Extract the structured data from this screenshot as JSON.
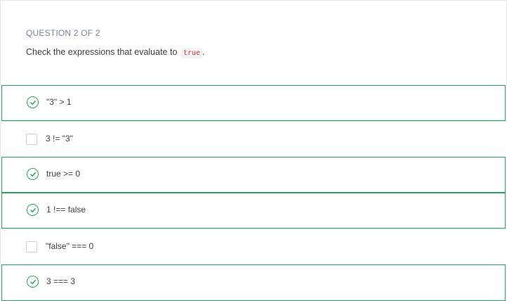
{
  "question": {
    "number_label": "QUESTION 2 OF 2",
    "prompt_text": "Check the expressions that evaluate to",
    "prompt_code": "true",
    "prompt_suffix": "."
  },
  "options": [
    {
      "label": "\"3\" > 1",
      "checked": true,
      "icon": "check-circle-icon"
    },
    {
      "label": "3 != \"3\"",
      "checked": false,
      "icon": "checkbox-icon"
    },
    {
      "label": "true >= 0",
      "checked": true,
      "icon": "check-circle-icon"
    },
    {
      "label": "1 !== false",
      "checked": true,
      "icon": "check-circle-icon"
    },
    {
      "label": "\"false\" === 0",
      "checked": false,
      "icon": "checkbox-icon"
    },
    {
      "label": "3 === 3",
      "checked": true,
      "icon": "check-circle-icon"
    }
  ],
  "colors": {
    "accent_green": "#27a55a",
    "code_red": "#d0373f",
    "muted_label": "#7a8392",
    "text": "#3d3d3d"
  }
}
